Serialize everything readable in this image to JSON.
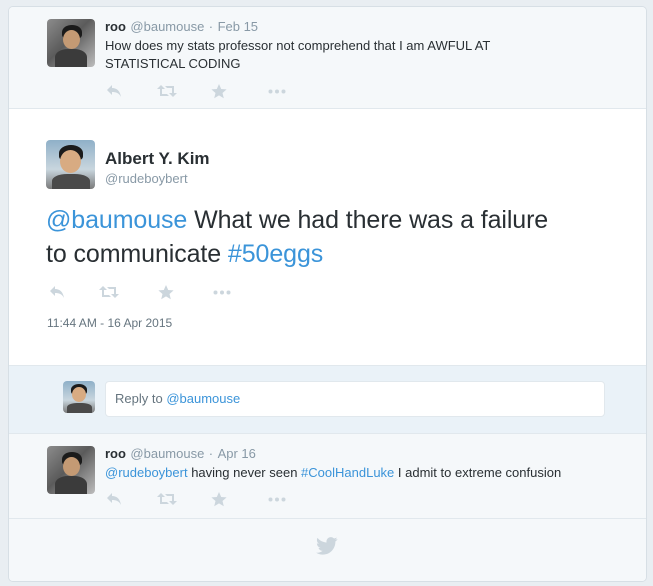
{
  "tweet1": {
    "name": "roo",
    "handle": "@baumouse",
    "separator": "·",
    "date": "Feb 15",
    "text_line1": "How does my stats professor not comprehend that I am AWFUL AT",
    "text_line2": "STATISTICAL CODING"
  },
  "main_tweet": {
    "name": "Albert Y. Kim",
    "handle": "@rudeboybert",
    "mention": "@baumouse",
    "text_part1": " What we had there was a failure",
    "text_part2": "to communicate ",
    "hashtag": "#50eggs",
    "timestamp": "11:44 AM - 16 Apr 2015"
  },
  "reply": {
    "placeholder_prefix": "Reply to ",
    "placeholder_handle": "@baumouse"
  },
  "tweet3": {
    "name": "roo",
    "handle": "@baumouse",
    "separator": "·",
    "date": "Apr 16",
    "mention": "@rudeboybert",
    "text_part1": " having never seen ",
    "hashtag": "#CoolHandLuke",
    "text_part2": " I admit to extreme confusion"
  },
  "icons": {
    "reply": "reply-icon",
    "retweet": "retweet-icon",
    "favorite": "star-icon",
    "more": "more-icon",
    "brand": "twitter-bird-icon"
  },
  "colors": {
    "link": "#3b94d9",
    "muted": "#8899a6",
    "icon": "#ccd6dd",
    "background": "#f5f8fa"
  }
}
